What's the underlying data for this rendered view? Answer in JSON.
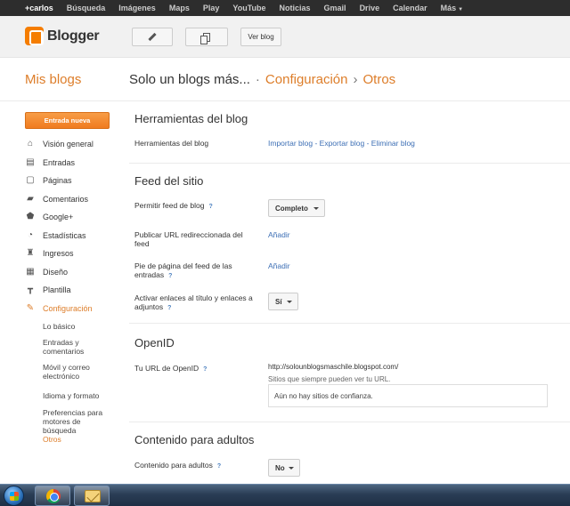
{
  "gbar": {
    "items": [
      "+carlos",
      "Búsqueda",
      "Imágenes",
      "Maps",
      "Play",
      "YouTube",
      "Noticias",
      "Gmail",
      "Drive",
      "Calendar",
      "Más"
    ]
  },
  "header": {
    "logo_text": "Blogger",
    "view_blog_label": "Ver blog"
  },
  "title": {
    "my_blogs": "Mis blogs",
    "blog_name": "Solo un blogs más...",
    "sep1": "·",
    "section": "Configuración",
    "sep2": "›",
    "page": "Otros"
  },
  "sidebar": {
    "new_post": "Entrada nueva",
    "items": [
      {
        "label": "Visión general",
        "icon": "home-icon"
      },
      {
        "label": "Entradas",
        "icon": "posts-icon"
      },
      {
        "label": "Páginas",
        "icon": "pages-icon"
      },
      {
        "label": "Comentarios",
        "icon": "comments-icon"
      },
      {
        "label": "Google+",
        "icon": "google-plus-icon"
      },
      {
        "label": "Estadísticas",
        "icon": "stats-icon"
      },
      {
        "label": "Ingresos",
        "icon": "earnings-icon"
      },
      {
        "label": "Diseño",
        "icon": "layout-icon"
      },
      {
        "label": "Plantilla",
        "icon": "template-icon"
      },
      {
        "label": "Configuración",
        "icon": "wrench-icon"
      }
    ],
    "subitems": [
      "Lo básico",
      "Entradas y comentarios",
      "Móvil y correo electrónico",
      "Idioma y formato",
      "Preferencias para motores de búsqueda",
      "Otros"
    ]
  },
  "main": {
    "tools": {
      "title": "Herramientas del blog",
      "label": "Herramientas del blog",
      "import": "Importar blog",
      "dash1": " - ",
      "export": "Exportar blog",
      "dash2": " - ",
      "delete": "Eliminar blog"
    },
    "feed": {
      "title": "Feed del sitio",
      "allow_label": "Permitir feed de blog",
      "allow_value": "Completo",
      "redirect_label": "Publicar URL redireccionada del feed",
      "redirect_link": "Añadir",
      "footer_label": "Pie de página del feed de las entradas",
      "footer_link": "Añadir",
      "enclosure_label": "Activar enlaces al título y enlaces a adjuntos",
      "enclosure_value": "Sí"
    },
    "openid": {
      "title": "OpenID",
      "label": "Tu URL de OpenID",
      "url": "http://solounblogsmaschile.blogspot.com/",
      "note": "Sitios que siempre pueden ver tu URL.",
      "empty": "Aún no hay sitios de confianza."
    },
    "adult": {
      "title": "Contenido para adultos",
      "label": "Contenido para adultos",
      "value": "No"
    },
    "help_mark": "?"
  }
}
